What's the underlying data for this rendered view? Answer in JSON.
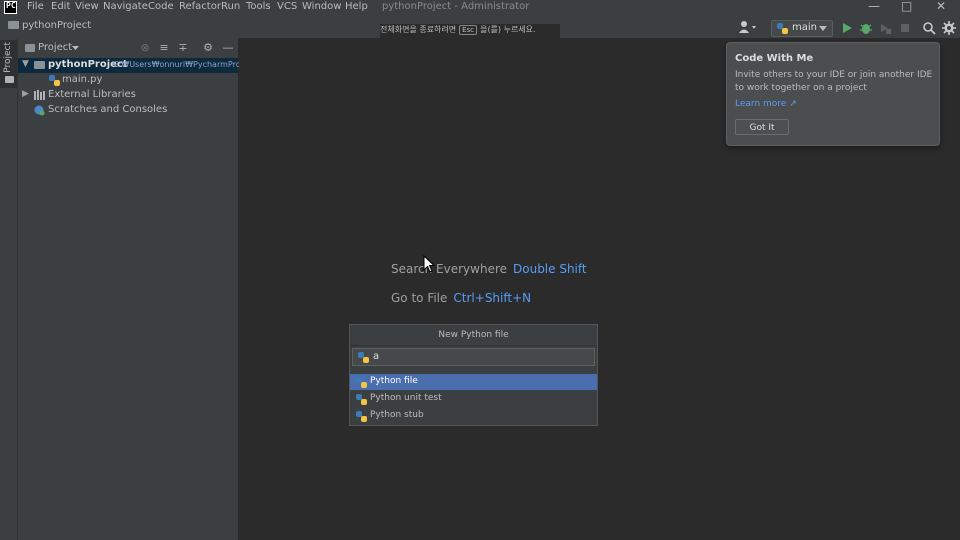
{
  "menubar": {
    "items": [
      "File",
      "Edit",
      "View",
      "Navigate",
      "Code",
      "Refactor",
      "Run",
      "Tools",
      "VCS",
      "Window",
      "Help"
    ],
    "window_title": "pythonProject - Administrator",
    "logo": "PC"
  },
  "navbar": {
    "project": "pythonProject",
    "fullscreen_hint_pre": "전체화면을 종료하려면",
    "fullscreen_hint_key": "Esc",
    "fullscreen_hint_post": "을(를) 누르세요.",
    "branch": "main"
  },
  "sidebar": {
    "tab_label": "Project"
  },
  "project_panel": {
    "title": "Project",
    "tree": {
      "root_name": "pythonProject",
      "root_path": "C:₩Users₩onnuri₩PycharmPro",
      "file": "main.py",
      "external": "External Libraries",
      "scratches": "Scratches and Consoles"
    }
  },
  "editor": {
    "hints": [
      {
        "label": "Search Everywhere",
        "key": "Double Shift"
      },
      {
        "label": "Go to File",
        "key": "Ctrl+Shift+N"
      }
    ]
  },
  "popup": {
    "title": "New Python file",
    "input_value": "a",
    "items": [
      "Python file",
      "Python unit test",
      "Python stub"
    ],
    "selected_index": 0
  },
  "tooltip": {
    "title": "Code With Me",
    "body": "Invite others to your IDE or join another IDE to work together on a project",
    "link": "Learn more ↗",
    "button": "Got It"
  },
  "colors": {
    "accent": "#4b6eaf",
    "link": "#589df6",
    "run_green": "#59a869"
  }
}
